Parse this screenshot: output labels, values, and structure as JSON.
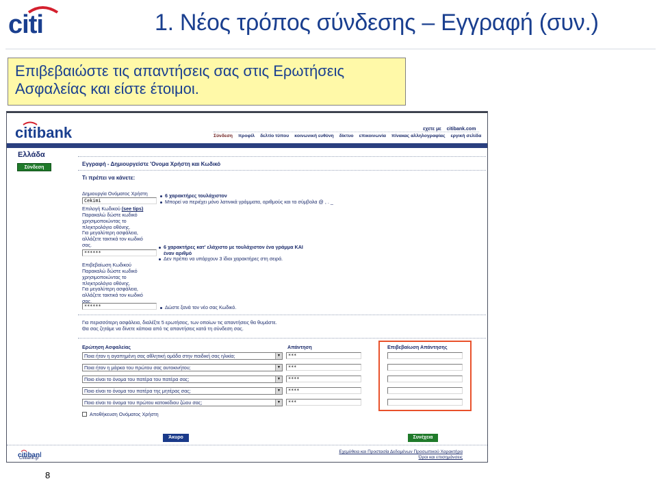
{
  "slide": {
    "title": "1. Νέος τρόπος σύνδεσης – Εγγραφή (συν.)",
    "callout": "Επιβεβαιώστε τις απαντήσεις σας στις Ερωτήσεις Ασφαλείας και είστε έτοιμοι.",
    "page_number": "8",
    "brand": "citi"
  },
  "screen": {
    "brand": "citibank",
    "country": "Ελλάδα",
    "left_login_button": "Σύνδεση",
    "top_links": [
      "εχετε με",
      "citibank.com"
    ],
    "nav": [
      "Σύνδεση",
      "προφίλ",
      "δελτίο τύπου",
      "κοινωνική ευθύνη",
      "δίκτυο",
      "επικοινωνία",
      "πίνακας αλληλογραφίας",
      "εργική σελίδα"
    ],
    "page_heading": "Εγγραφή - Δημιουργείστε 'Ονομα Χρήστη και Κωδικό",
    "sub_heading": "Τι πρέπει να κάνετε:",
    "username": {
      "label": "Δημιουργία Ονόματος Χρήστη",
      "value": "Cekimi",
      "hints": [
        "6 χαρακτήρες τουλάχιστον",
        "Μπορεί να περιέχει μόνο λατινικά γράμματα, αριθμούς και τα σύμβολα @ , . _"
      ]
    },
    "password": {
      "label": "Επιλογή Κωδικού",
      "tips_link": "(see tips)",
      "help": [
        "Παρακαλώ δώστε κωδικό",
        "χρησιμοποιώντας το",
        "πληκτρολόγιο οθόνης.",
        "Για μεγαλύτερη ασφάλεια,",
        "αλλάζετε τακτικά τον κωδικό",
        "σας."
      ],
      "value": "******",
      "hints": [
        "6 χαρακτήρες κατ' ελάχιστο με τουλάχιστον ένα γράμμα ΚΑΙ",
        "έναν αριθμό",
        "Δεν πρέπει να υπάρχουν 3 ίδιοι χαρακτήρες στη σειρά."
      ]
    },
    "confirm_password": {
      "label": "Επιβεβαίωση Κωδικού",
      "help": [
        "Παρακαλώ δώστε κωδικό",
        "χρησιμοποιώντας το",
        "πληκτρολόγιο οθόνης.",
        "Για μεγαλύτερη ασφάλεια,",
        "αλλάζετε τακτικά τον κωδικό",
        "σας."
      ],
      "value": "******",
      "hint": "Δώστε ξανά τον νέο σας Κωδικό."
    },
    "security_intro": [
      "Για περισσότερη ασφάλεια, διαλέξτε 5 ερωτήσεις, των οποίων τις απαντήσεις θα θυμάστε.",
      "Θα σας ζητάμε να δίνετε κάποια από τις απαντήσεις κατά τη σύνδεση σας."
    ],
    "columns": {
      "question": "Ερώτηση Ασφαλείας",
      "answer": "Απάντηση",
      "confirm": "Επιβεβαίωση Απάντησης"
    },
    "questions": [
      {
        "q": "Ποια ήταν η αγαπημένη σας αθλητική ομάδα στην παιδική σας ηλικία;",
        "answer": "***",
        "confirm": ""
      },
      {
        "q": "Ποια ήταν η μάρκα του πρώτου σας αυτοκινήτου;",
        "answer": "***",
        "confirm": ""
      },
      {
        "q": "Ποιο είναι το όνομα του πατέρα του πατέρα σας;",
        "answer": "****",
        "confirm": ""
      },
      {
        "q": "Ποιο είναι το όνομα του πατέρα της μητέρας σας;",
        "answer": "****",
        "confirm": ""
      },
      {
        "q": "Ποιο είναι το όνομα του πρώτου κατοικίδιου ζώου σας;",
        "answer": "***",
        "confirm": ""
      }
    ],
    "save_username": "Αποθήκευση Ονόματος Χρήστη",
    "cancel_button": "Άκυρο",
    "continue_button": "Συνέχεια",
    "footer": {
      "domain": "Citibank.gr",
      "links": [
        "Εχεμύθεια και Προστασία Δεδομένων Προσωπικού Χαρακτήρα",
        "Όροι και επισημάνσεις"
      ]
    }
  },
  "colors": {
    "title_blue": "#1a3f8f",
    "callout_yellow": "#fff9a8",
    "highlight_orange": "#e8502a",
    "nav_navy": "#2a3f7f",
    "button_green": "#1f7a2a"
  }
}
